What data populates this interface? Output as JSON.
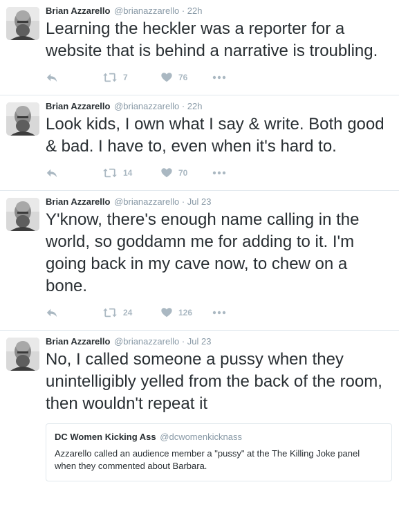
{
  "colors": {
    "text": "#292f33",
    "muted": "#8899a6",
    "icon": "#aab8c2",
    "border": "#e1e8ed"
  },
  "icons": {
    "reply": "reply-icon",
    "retweet": "retweet-icon",
    "like": "heart-icon",
    "more": "more-dots-icon"
  },
  "tweets": [
    {
      "name": "Brian Azzarello",
      "handle": "@brianazzarello",
      "separator": "·",
      "time": "22h",
      "text": "Learning the heckler was a reporter for a website that is behind a narrative is troubling.",
      "retweets": "7",
      "likes": "76"
    },
    {
      "name": "Brian Azzarello",
      "handle": "@brianazzarello",
      "separator": "·",
      "time": "22h",
      "text": "Look kids, I own what I say & write. Both good & bad. I have to, even when it's hard to.",
      "retweets": "14",
      "likes": "70"
    },
    {
      "name": "Brian Azzarello",
      "handle": "@brianazzarello",
      "separator": "·",
      "time": "Jul 23",
      "text": "Y'know, there's enough name calling in the world, so goddamn me for adding to it. I'm going back in my cave now, to chew on a bone.",
      "retweets": "24",
      "likes": "126"
    },
    {
      "name": "Brian Azzarello",
      "handle": "@brianazzarello",
      "separator": "·",
      "time": "Jul 23",
      "text": "No, I called someone a pussy when they unintelligibly yelled from the back of the room, then wouldn't repeat it",
      "quote": {
        "name": "DC Women Kicking Ass",
        "handle": "@dcwomenkicknass",
        "text": "Azzarello called an audience member a \"pussy\" at the The Killing Joke panel when they commented about Barbara."
      }
    }
  ]
}
